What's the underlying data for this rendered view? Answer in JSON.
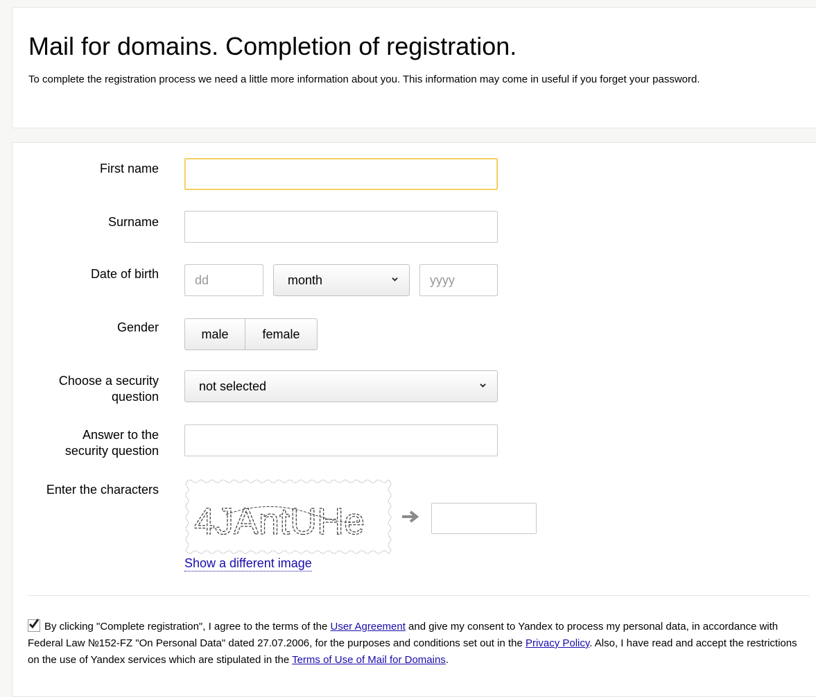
{
  "header": {
    "title": "Mail for domains. Completion of registration.",
    "intro": "To complete the registration process we need a little more information about you. This information may come in useful if you forget your password."
  },
  "form": {
    "first_name_label": "First name",
    "surname_label": "Surname",
    "dob_label": "Date of birth",
    "dob_day_placeholder": "dd",
    "dob_month_value": "month",
    "dob_year_placeholder": "yyyy",
    "gender_label": "Gender",
    "gender_male": "male",
    "gender_female": "female",
    "security_question_label_1": "Choose a security",
    "security_question_label_2": "question",
    "security_question_value": "not selected",
    "answer_label_1": "Answer to the",
    "answer_label_2": "security question",
    "captcha_label": "Enter the characters",
    "captcha_text": "4JAntUHe",
    "captcha_refresh": "Show a different image"
  },
  "consent": {
    "part1": "By clicking \"Complete registration\", I agree to the terms of the ",
    "link1": "User Agreement",
    "part2": " and give my consent to Yandex to process my personal data, in accordance with Federal Law №152-FZ \"On Personal Data\" dated 27.07.2006, for the purposes and conditions set out in the ",
    "link2": "Privacy Policy",
    "part3": ". Also, I have read and accept the restrictions on the use of Yandex services which are stipulated in the ",
    "link3": "Terms of Use of Mail for Domains",
    "part4": "."
  },
  "colors": {
    "focus_border": "#f5c94d",
    "link": "#1a0dab"
  }
}
